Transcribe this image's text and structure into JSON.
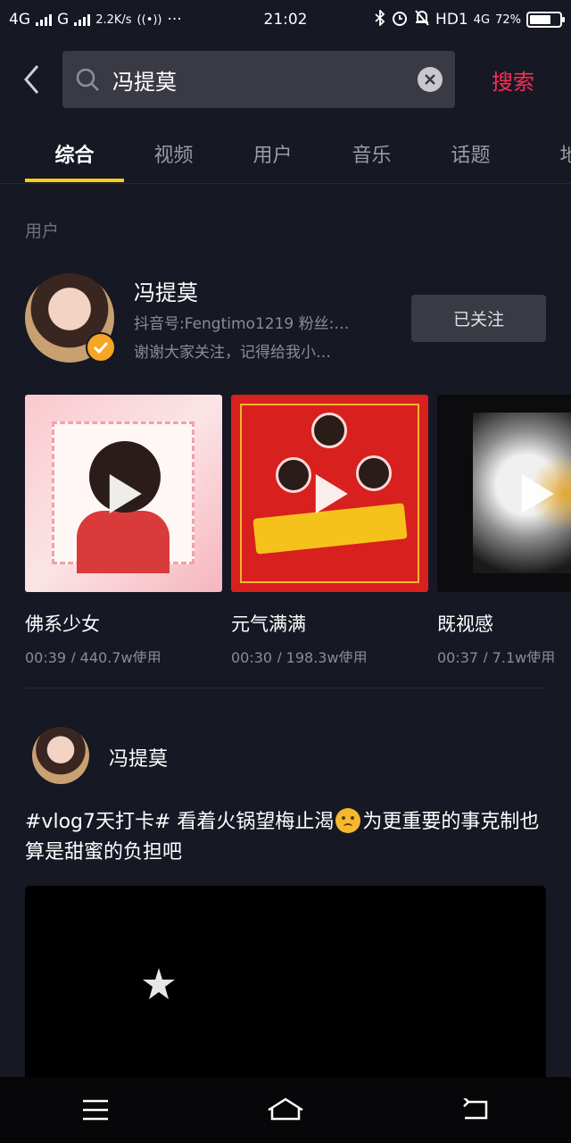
{
  "status_bar": {
    "network1": "4G",
    "network2": "G",
    "speed": "2.2K/s",
    "dots": "···",
    "time": "21:02",
    "hd": "HD1",
    "net_small": "4G",
    "battery_pct": "72%",
    "battery_level": 0.72
  },
  "search": {
    "query": "冯提莫",
    "submit_label": "搜索"
  },
  "tabs": [
    {
      "label": "综合",
      "active": true
    },
    {
      "label": "视频"
    },
    {
      "label": "用户"
    },
    {
      "label": "音乐"
    },
    {
      "label": "话题"
    },
    {
      "label": "地"
    }
  ],
  "users_section": {
    "label": "用户",
    "user": {
      "name": "冯提莫",
      "id_line": "抖音号:Fengtimo1219 粉丝:…",
      "bio": "谢谢大家关注，记得给我小…",
      "follow_label": "已关注"
    }
  },
  "music": [
    {
      "title": "佛系少女",
      "meta": "00:39 / 440.7w使用"
    },
    {
      "title": "元气满满",
      "meta": "00:30 / 198.3w使用"
    },
    {
      "title": "既视感",
      "meta": "00:37 / 7.1w使用"
    }
  ],
  "post": {
    "author": "冯提莫",
    "text_before": "#vlog7天打卡# 看着火锅望梅止渴",
    "text_after": "为更重要的事克制也算是甜蜜的负担吧"
  },
  "icons": {
    "back": "chevron-left-icon",
    "search": "search-icon",
    "clear": "clear-icon",
    "verify": "verified-badge-icon",
    "play": "play-icon",
    "menu": "menu-icon",
    "home": "home-icon",
    "back_nav": "back-nav-icon"
  },
  "colors": {
    "background": "#161823",
    "accent_red": "#fe2c55",
    "tab_indicator": "#face15",
    "verify_badge": "#f5a623"
  }
}
